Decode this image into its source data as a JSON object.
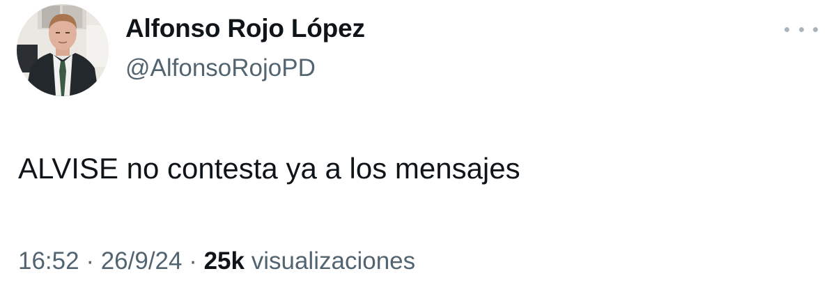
{
  "tweet": {
    "author_name": "Alfonso Rojo López",
    "author_handle": "@AlfonsoRojoPD",
    "text": "ALVISE no contesta ya a los mensajes",
    "time": "16:52",
    "separator": " · ",
    "date": "26/9/24",
    "views_count": "25k",
    "views_label": " visualizaciones"
  },
  "icons": {
    "more": "more-options-icon",
    "avatar": "profile-photo"
  },
  "colors": {
    "primary_text": "#0f1419",
    "secondary_text": "#536471",
    "more_icon": "#aab4bc",
    "background": "#ffffff"
  }
}
